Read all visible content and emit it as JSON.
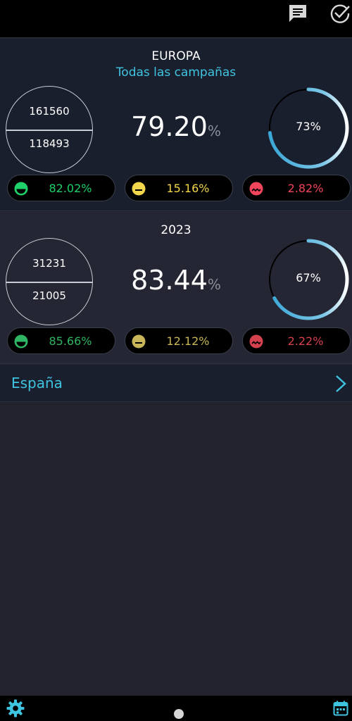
{
  "colors": {
    "accent": "#3fc4e0",
    "positive": "#1fd16a",
    "neutral": "#f2d64b",
    "negative": "#f0455a",
    "positive_dim": "#2fb563",
    "neutral_dim": "#c9b65a",
    "negative_dim": "#d4424f"
  },
  "topbar": {
    "icons": [
      "chat-icon",
      "check-circle-icon"
    ]
  },
  "sections": [
    {
      "title": "EUROPA",
      "subtitle": "Todas las campañas",
      "count_top": "161560",
      "count_bottom": "118493",
      "percentage": "79.20",
      "percentage_unit": "%",
      "ring_label": "73%",
      "ring_value": 73,
      "pills": [
        {
          "icon": "happy-face-icon",
          "value": "82.02%"
        },
        {
          "icon": "neutral-face-icon",
          "value": "15.16%"
        },
        {
          "icon": "sad-face-icon",
          "value": "2.82%"
        }
      ]
    },
    {
      "title": "2023",
      "count_top": "31231",
      "count_bottom": "21005",
      "percentage": "83.44",
      "percentage_unit": "%",
      "ring_label": "67%",
      "ring_value": 67,
      "pills": [
        {
          "icon": "happy-face-icon",
          "value": "85.66%"
        },
        {
          "icon": "neutral-face-icon",
          "value": "12.12%"
        },
        {
          "icon": "sad-face-icon",
          "value": "2.22%"
        }
      ]
    }
  ],
  "nav": {
    "label": "España",
    "icon": "chevron-right-icon"
  },
  "bottombar": {
    "icons": [
      "gear-icon",
      "calendar-icon"
    ]
  }
}
